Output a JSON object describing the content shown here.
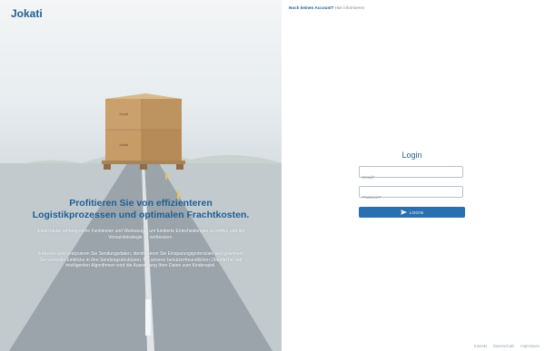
{
  "brand": {
    "name": "Jokati"
  },
  "hero": {
    "headline": "Profitieren Sie von effizienteren Logistikprozessen und optimalen Frachtkosten.",
    "paragraph1": "Jokati bietet umfangreiche Funktionen und Werkzeuge, um fundierte Entscheidungen zu treffen und die Versandstrategie zu verbessern.",
    "paragraph2": "Erfassen und analysieren Sie Sendungsdaten, identifizieren Sie Einsparungspotenziale und gewinnen Sie wertvolle Einblicke in Ihre Sendungsstrukturen. Mit unserer benutzerfreundlichen Oberfläche und intelligenten Algorithmen wird die Auswertung Ihrer Daten zum Kinderspiel.",
    "box_label": "Jokati"
  },
  "topbar": {
    "register_link": "Noch keinen Account?",
    "more_link": "Hier informieren"
  },
  "login": {
    "title": "Login",
    "email_placeholder": "Email*",
    "password_placeholder": "Passwort*",
    "submit_label": "LOGIN"
  },
  "footer": {
    "links": [
      "Kontakt",
      "Datenschutz",
      "Impressum"
    ]
  },
  "colors": {
    "brand": "#1f5f93",
    "button": "#2a6fb0"
  },
  "icons": {
    "submit": "send-icon"
  }
}
